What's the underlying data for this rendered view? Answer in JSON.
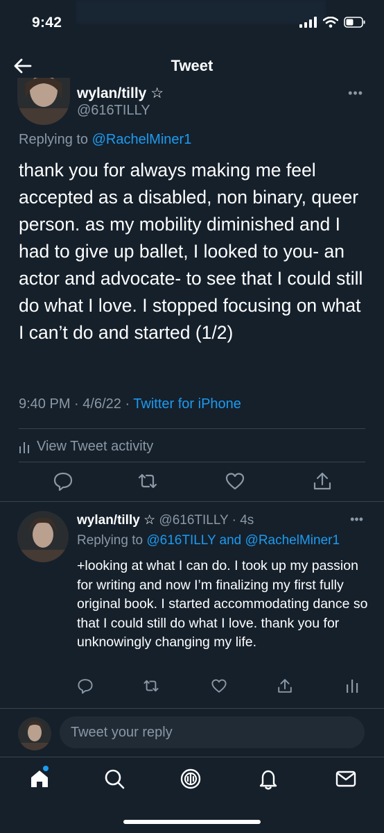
{
  "status": {
    "time": "9:42"
  },
  "header": {
    "title": "Tweet"
  },
  "main_tweet": {
    "author_name": "wylan/tilly ☆",
    "author_handle": "@616TILLY",
    "replying_prefix": "Replying to",
    "replying_to": "@RachelMiner1",
    "text": "thank you for always making me feel accepted as a disabled, non binary, queer person. as my mobility diminished and I had to give up ballet, I looked to you- an actor and advocate- to see that I could still do what I love. I stopped focusing on what I can’t do and started (1/2)",
    "time": "9:40 PM",
    "date": "4/6/22",
    "source": "Twitter for iPhone",
    "activity_label": "View Tweet activity"
  },
  "reply_tweet": {
    "author_name": "wylan/tilly ☆",
    "author_handle": "@616TILLY",
    "age": "4s",
    "replying_prefix": "Replying to",
    "replying_to": "@616TILLY and @RachelMiner1",
    "text": "+looking at what I can do. I took up my passion for writing and now I’m finalizing my first fully original book. I started accommodating dance so that I could still do what I love. thank you for unknowingly changing my life."
  },
  "compose": {
    "placeholder": "Tweet your reply"
  },
  "colors": {
    "background": "#15202b",
    "accent": "#1d9bf0",
    "muted": "#8b98a5",
    "divider": "#38444d"
  },
  "icons": [
    "back-arrow-icon",
    "reply-icon",
    "retweet-icon",
    "like-icon",
    "share-icon",
    "analytics-icon",
    "home-icon",
    "search-icon",
    "spaces-icon",
    "notifications-icon",
    "messages-icon"
  ]
}
